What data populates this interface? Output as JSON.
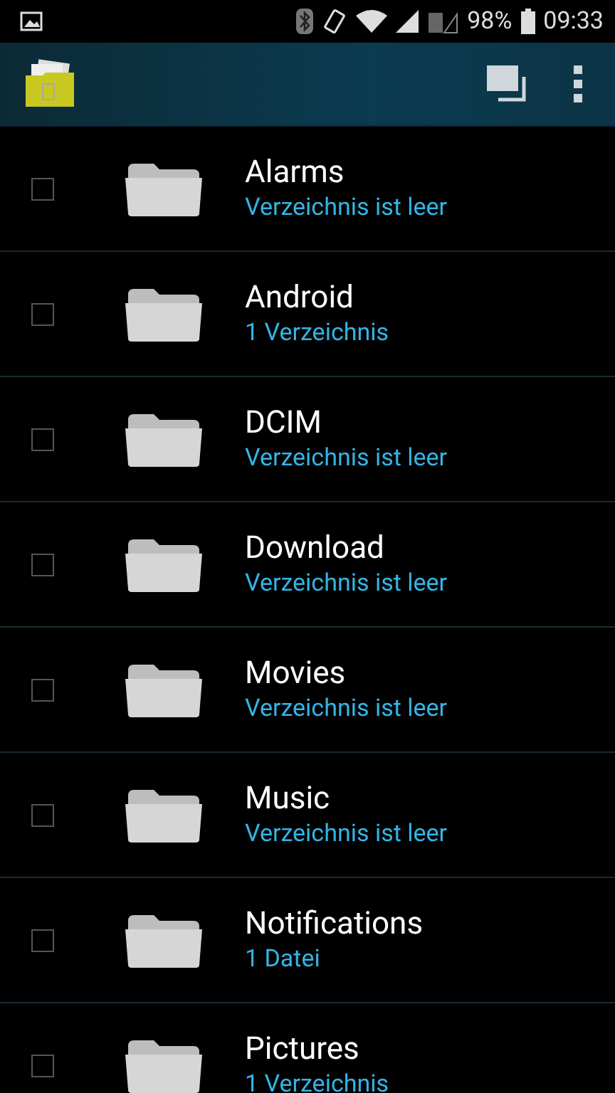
{
  "status_bar": {
    "battery": "98%",
    "time": "09:33"
  },
  "folders": [
    {
      "name": "Alarms",
      "info": "Verzeichnis ist leer",
      "checked": false
    },
    {
      "name": "Android",
      "info": "1 Verzeichnis",
      "checked": false
    },
    {
      "name": "DCIM",
      "info": "Verzeichnis ist leer",
      "checked": false
    },
    {
      "name": "Download",
      "info": "Verzeichnis ist leer",
      "checked": false
    },
    {
      "name": "Movies",
      "info": "Verzeichnis ist leer",
      "checked": false
    },
    {
      "name": "Music",
      "info": "Verzeichnis ist leer",
      "checked": false
    },
    {
      "name": "Notifications",
      "info": "1 Datei",
      "checked": false
    },
    {
      "name": "Pictures",
      "info": "1 Verzeichnis",
      "checked": false
    }
  ]
}
